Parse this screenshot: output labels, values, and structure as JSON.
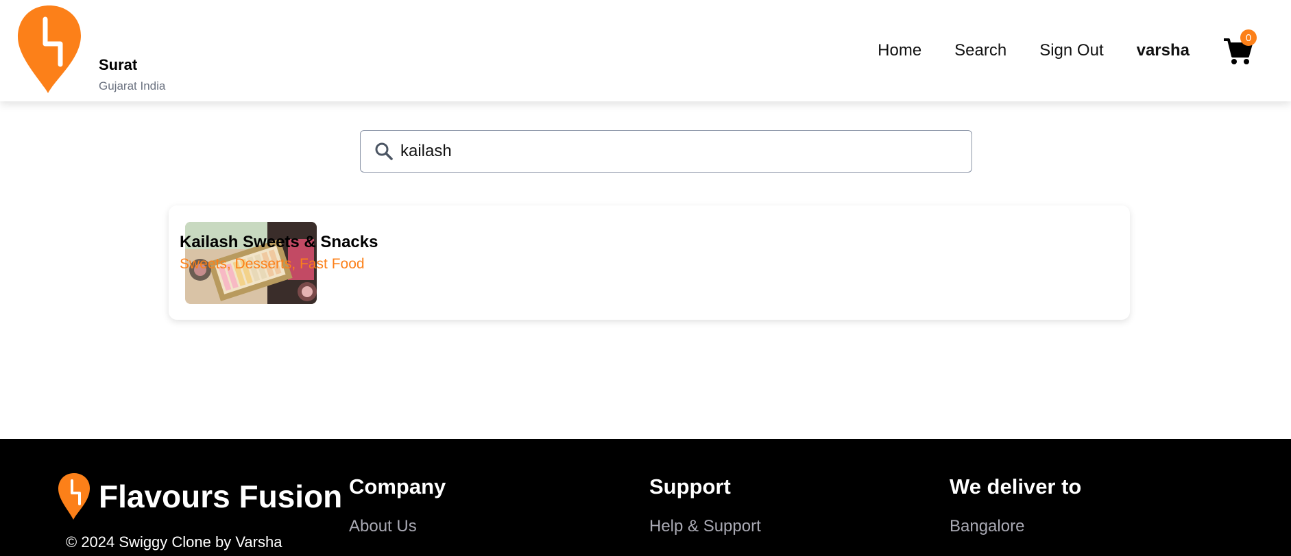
{
  "colors": {
    "accent": "#fc8019",
    "footer_bg": "#000000",
    "muted_text": "#6b7280"
  },
  "header": {
    "logo_icon": "swiggy-logo-icon",
    "location_city": "Surat",
    "location_region": "Gujarat India",
    "nav": {
      "home": "Home",
      "search": "Search",
      "sign_out": "Sign Out",
      "user": "varsha"
    },
    "cart_icon": "cart-icon",
    "cart_count": "0"
  },
  "search": {
    "icon": "search-icon",
    "value": "kailash",
    "placeholder": ""
  },
  "results": [
    {
      "name": "Kailash Sweets & Snacks",
      "cuisines": "Sweets, Desserts, Fast Food",
      "image": "sweets-box-image"
    }
  ],
  "footer": {
    "brand": "Flavours Fusion",
    "copyright": "© 2024 Swiggy Clone by Varsha",
    "columns": [
      {
        "title": "Company",
        "links": [
          "About Us"
        ]
      },
      {
        "title": "Support",
        "links": [
          "Help & Support"
        ]
      },
      {
        "title": "We deliver to",
        "links": [
          "Bangalore"
        ]
      }
    ]
  }
}
